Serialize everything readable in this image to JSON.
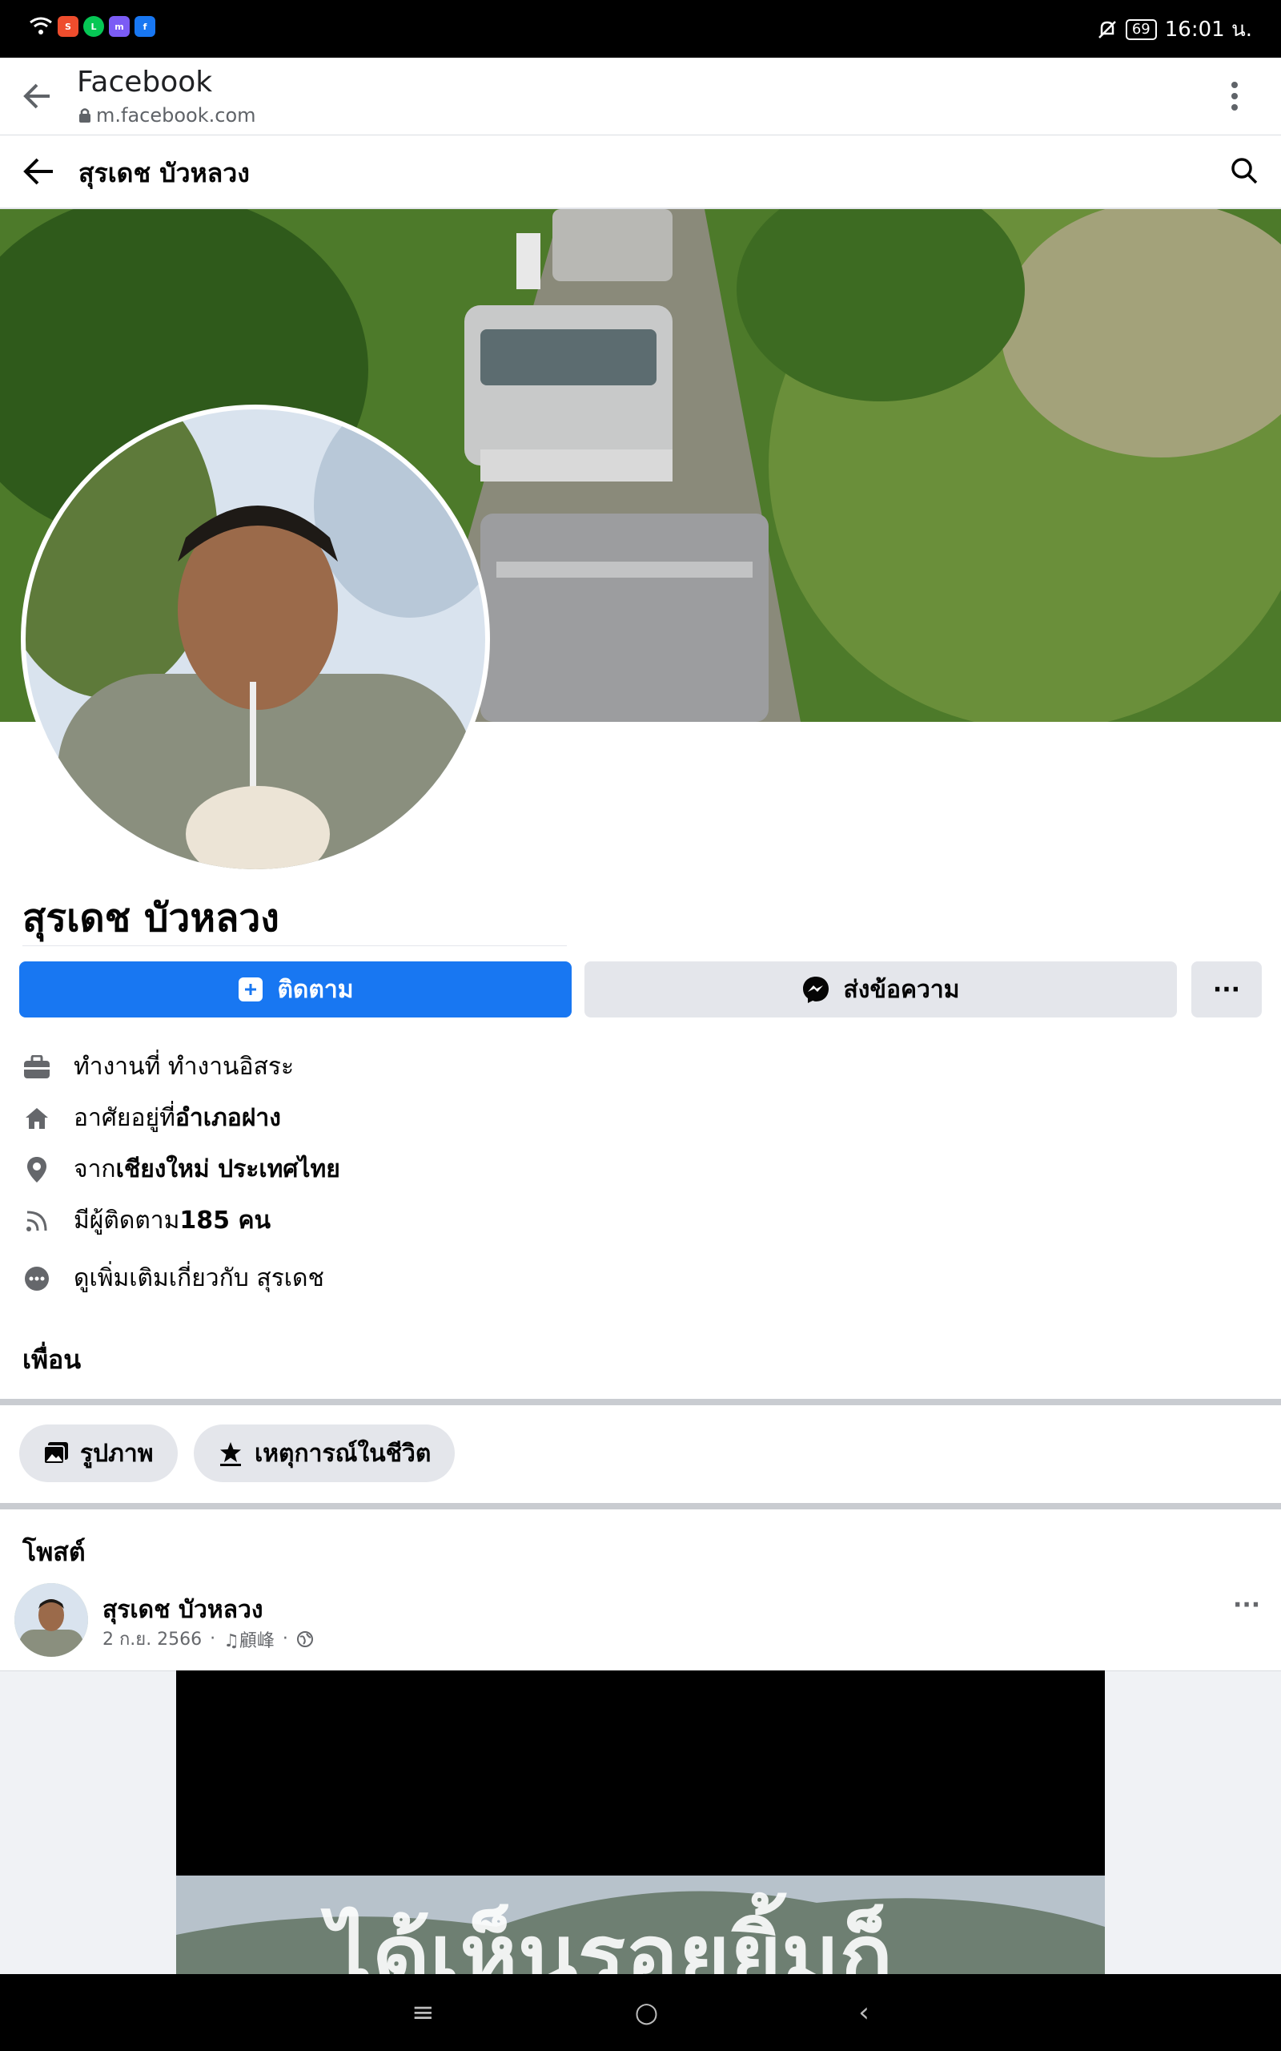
{
  "status_bar": {
    "battery": "69",
    "time": "16:01 น.",
    "app_icons": [
      "shopee-icon",
      "line-icon",
      "messenger-icon",
      "facebook-icon"
    ]
  },
  "browser": {
    "title": "Facebook",
    "url": "m.facebook.com"
  },
  "header": {
    "title": "สุรเดช บัวหลวง"
  },
  "profile": {
    "name": "สุรเดช บัวหลวง",
    "follow_label": "ติดตาม",
    "message_label": "ส่งข้อความ",
    "more_label": "···"
  },
  "intro": {
    "work_prefix": "ทำงานที่ ทำงานอิสระ",
    "lives_prefix": "อาศัยอยู่ที่ ",
    "lives_value": "อำเภอฝาง",
    "from_prefix": "จาก ",
    "from_value": "เชียงใหม่ ประเทศไทย",
    "followers_prefix": "มีผู้ติดตาม ",
    "followers_value": "185 คน",
    "see_more": "ดูเพิ่มเติมเกี่ยวกับ สุรเดช"
  },
  "friends_heading": "เพื่อน",
  "tabs": {
    "photos": "รูปภาพ",
    "life_events": "เหตุการณ์ในชีวิต"
  },
  "posts_heading": "โพสต์",
  "post": {
    "author": "สุรเดช บัวหลวง",
    "date": "2 ก.ย. 2566",
    "music": "♫顧峰",
    "dot": "·",
    "more": "···",
    "video_text": "ได้เห็นรอยยิ้มก็"
  },
  "colors": {
    "primary": "#1877f2",
    "secondary_button": "#e4e6eb",
    "text_secondary": "#65676b"
  },
  "navbar": {
    "menu": "≡",
    "home": "○",
    "back": "‹"
  }
}
